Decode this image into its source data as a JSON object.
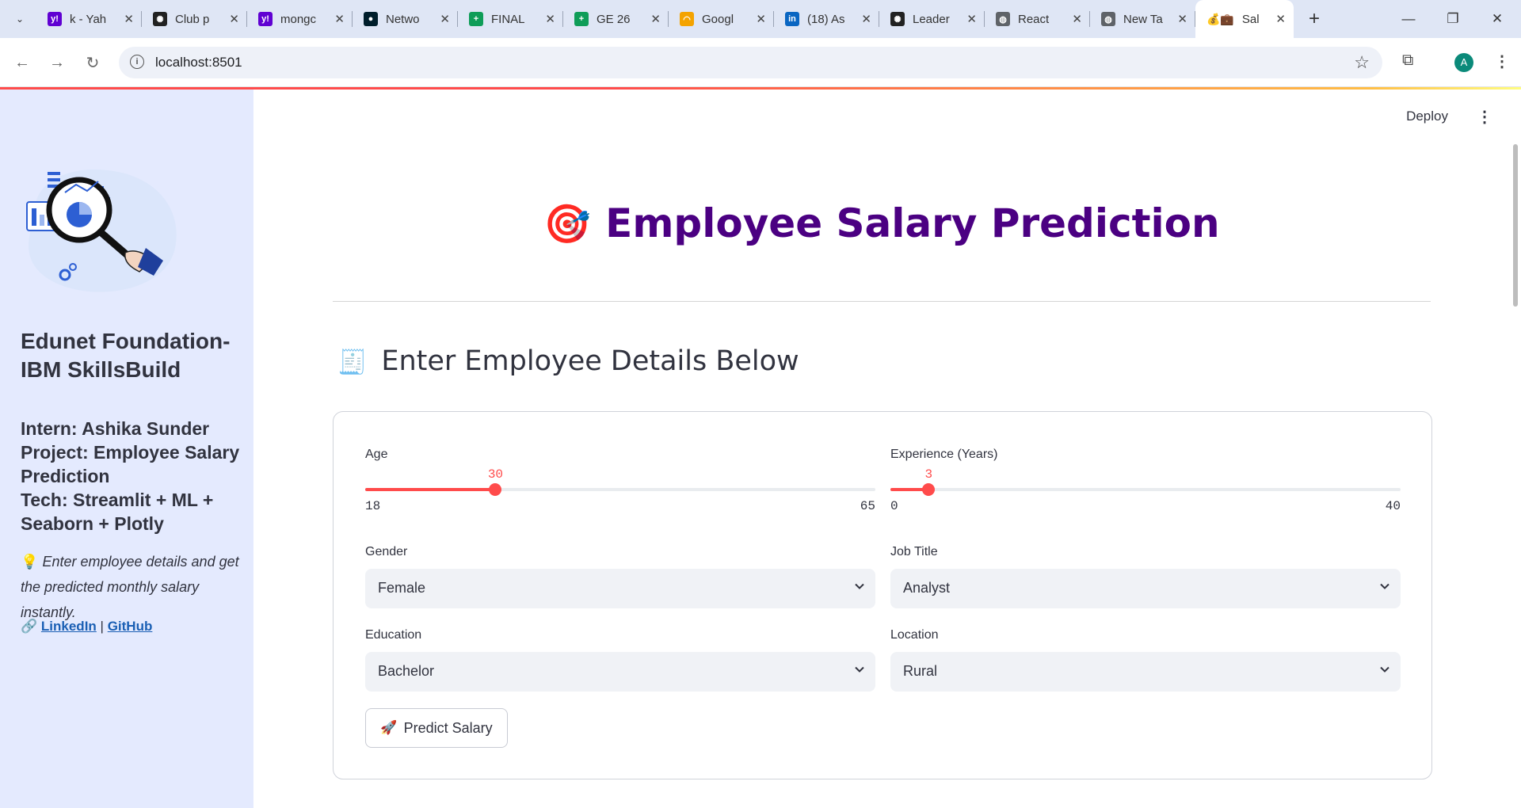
{
  "browser": {
    "tabs": [
      {
        "title": "k - Yah",
        "favicon": "yahoo-icon",
        "color": "#6001d2",
        "glyph": "y!"
      },
      {
        "title": "Club p",
        "favicon": "openai-icon",
        "color": "#222222",
        "glyph": "✺"
      },
      {
        "title": "mongc",
        "favicon": "yahoo-icon",
        "color": "#6001d2",
        "glyph": "y!"
      },
      {
        "title": "Netwo",
        "favicon": "mongodb-icon",
        "color": "#001e2b",
        "glyph": "●"
      },
      {
        "title": "FINAL",
        "favicon": "sheets-icon",
        "color": "#0f9d58",
        "glyph": "+"
      },
      {
        "title": "GE 26",
        "favicon": "sheets-icon",
        "color": "#0f9d58",
        "glyph": "+"
      },
      {
        "title": "Googl",
        "favicon": "rainbow-icon",
        "color": "#f4a300",
        "glyph": "◠"
      },
      {
        "title": "(18) As",
        "favicon": "linkedin-icon",
        "color": "#0a66c2",
        "glyph": "in"
      },
      {
        "title": "Leader",
        "favicon": "openai-icon",
        "color": "#222222",
        "glyph": "✺"
      },
      {
        "title": "React",
        "favicon": "globe-icon",
        "color": "#5f6368",
        "glyph": "◍"
      },
      {
        "title": "New Ta",
        "favicon": "globe-icon",
        "color": "#5f6368",
        "glyph": "◍"
      }
    ],
    "active_tab": {
      "title": "Sal",
      "favicon": "money-bag-icon",
      "glyph": "💰💼"
    },
    "url": "localhost:8501"
  },
  "app": {
    "deploy_label": "Deploy",
    "title_emoji": "🎯",
    "title": "Employee Salary Prediction",
    "subheader_emoji": "🧾",
    "subheader": "Enter Employee Details Below",
    "form": {
      "age": {
        "label": "Age",
        "value": 30,
        "min": 18,
        "max": 65
      },
      "experience": {
        "label": "Experience (Years)",
        "value": 3,
        "min": 0,
        "max": 40
      },
      "gender": {
        "label": "Gender",
        "value": "Female"
      },
      "job_title": {
        "label": "Job Title",
        "value": "Analyst"
      },
      "education": {
        "label": "Education",
        "value": "Bachelor"
      },
      "location": {
        "label": "Location",
        "value": "Rural"
      },
      "submit_emoji": "🚀",
      "submit_label": "Predict Salary"
    },
    "accent_color": "#ff4b4b",
    "title_color": "#4b0082"
  },
  "sidebar": {
    "org": "Edunet Foundation-IBM SkillsBuild",
    "intern": "Intern: Ashika Sunder",
    "project": "Project: Employee Salary Prediction",
    "tech": "Tech: Streamlit + ML + Seaborn + Plotly",
    "tip_emoji": "💡",
    "tip": "Enter employee details and get the predicted monthly salary instantly.",
    "links_emoji": "🔗",
    "link_linkedin": "LinkedIn",
    "link_separator": "|",
    "link_github": "GitHub",
    "illustration": "analytics-magnifier-illustration"
  }
}
